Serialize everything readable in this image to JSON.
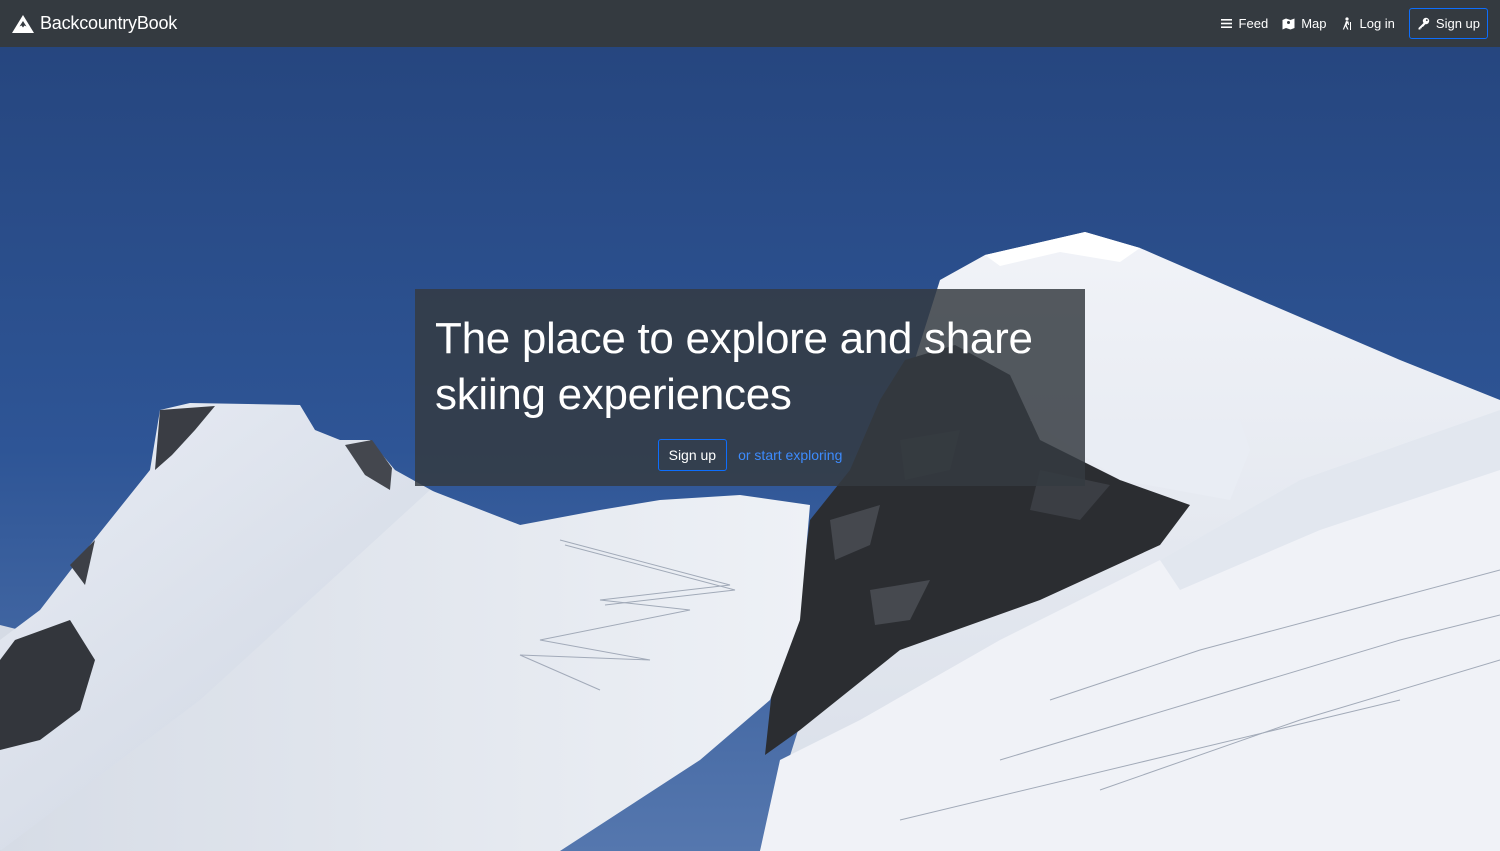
{
  "navbar": {
    "brand": "BackcountryBook",
    "brand_icon": "mountain-icon",
    "links": [
      {
        "label": "Feed",
        "icon": "list-icon"
      },
      {
        "label": "Map",
        "icon": "map-icon"
      },
      {
        "label": "Log in",
        "icon": "hiker-icon"
      }
    ],
    "signup": {
      "label": "Sign up",
      "icon": "key-icon"
    }
  },
  "hero": {
    "headline": "The place to explore and share skiing experiences",
    "signup_label": "Sign up",
    "explore_label": "or start exploring"
  },
  "colors": {
    "navbar_bg": "#343a40",
    "accent": "#0d6efd",
    "link": "#3d8bfd",
    "sky": "#2b4d8a"
  }
}
